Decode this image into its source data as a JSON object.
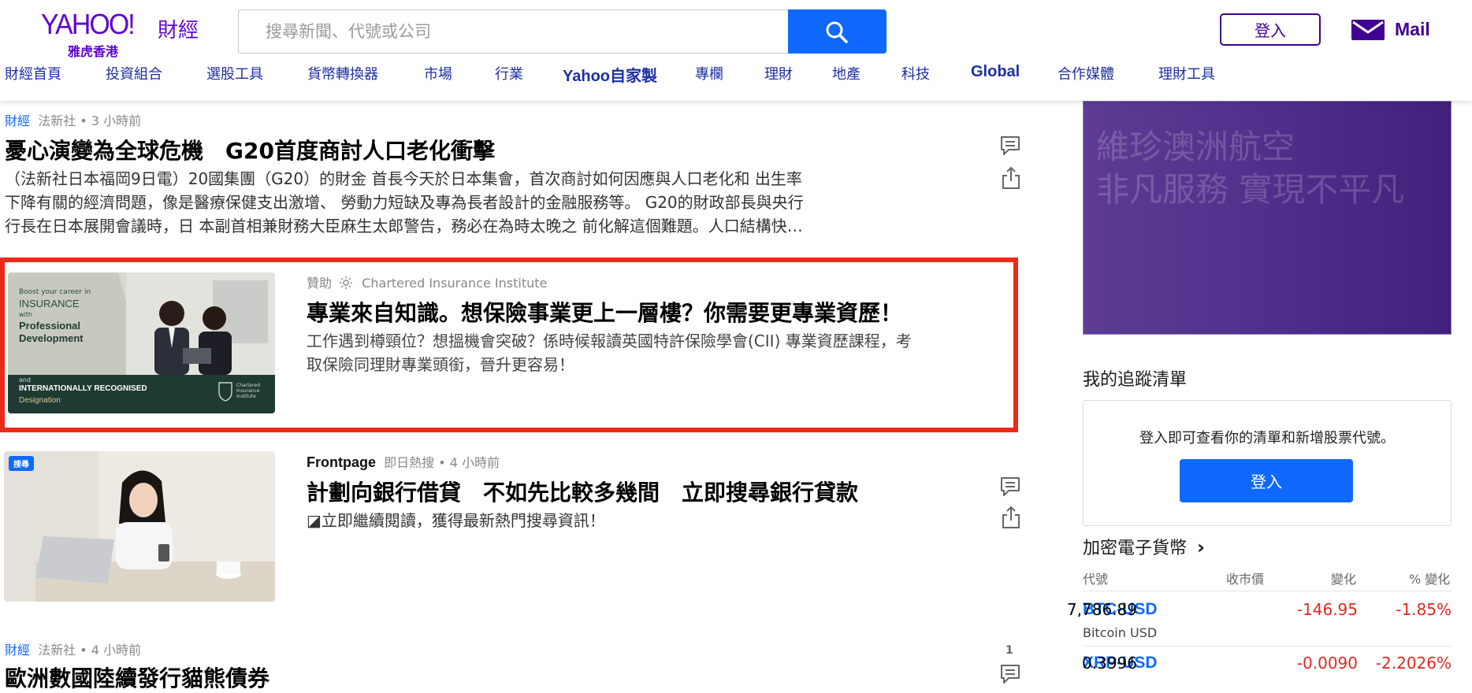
{
  "header": {
    "logo": {
      "brand": "YAHOO!",
      "section": "財經",
      "region": "雅虎香港"
    },
    "search": {
      "placeholder": "搜尋新聞、代號或公司"
    },
    "signin_label": "登入",
    "mail_label": "Mail",
    "nav": [
      "財經首頁",
      "投資組合",
      "選股工具",
      "貨幣轉換器",
      "市場",
      "行業",
      "Yahoo自家製",
      "專欄",
      "理財",
      "地產",
      "科技",
      "Global",
      "合作媒體",
      "理財工具"
    ]
  },
  "feed": {
    "item1": {
      "category": "財經",
      "meta": "法新社 • 3 小時前",
      "headline": "憂心演變為全球危機　G20首度商討人口老化衝擊",
      "summary_lines": [
        "（法新社日本福岡9日電）20國集團（G20）的財金 首長今天於日本集會，首次商討如何因應與人口老化和 出生率",
        "下降有關的經濟問題，像是醫療保健支出激增、 勞動力短缺及專為長者設計的金融服務等。 G20的財政部長與央行",
        "行長在日本展開會議時，日 本副首相兼財務大臣麻生太郎警告，務必在為時太晚之 前化解這個難題。人口結構快…"
      ]
    },
    "sponsored": {
      "label": "贊助",
      "advertiser": "Chartered Insurance Institute",
      "headline": "專業來自知識。想保險事業更上一層樓？你需要更專業資歷！",
      "summary_lines": [
        "工作遇到樽頸位？想搵機會突破？係時候報讀英國特許保險學會(CII) 專業資歷課程，考",
        "取保險同理財專業頭銜，晉升更容易！"
      ],
      "image_text": {
        "top": "Boost your career in",
        "insurance": "INSURANCE",
        "with": "with",
        "professional": "Professional",
        "development": "Development",
        "and": "and",
        "intl": "INTERNATIONALLY RECOGNISED",
        "designation": "Designation",
        "cii": "Chartered Insurance Institute"
      }
    },
    "item3": {
      "source": "Frontpage",
      "meta": "即日熱搜 • 4 小時前",
      "headline": "計劃向銀行借貸　不如先比較多幾間　立即搜尋銀行貸款",
      "summary": "◪立即繼續閱讀，獲得最新熱門搜尋資訊！",
      "badge": "搜尋"
    },
    "item4": {
      "category": "財經",
      "meta": "法新社 • 4 小時前",
      "headline": "歐洲數國陸續發行貓熊債券",
      "comment_count": "1"
    }
  },
  "rail": {
    "ad": {
      "line1": "維珍澳洲航空",
      "line2": "非凡服務 實現不平凡"
    },
    "watchlist": {
      "title": "我的追蹤清單",
      "message": "登入即可查看你的清單和新增股票代號。",
      "signin_label": "登入"
    },
    "crypto": {
      "title": "加密電子貨幣",
      "chevron": "›",
      "columns": [
        "代號",
        "收市價",
        "變化",
        "% 變化"
      ],
      "rows": [
        {
          "symbol": "BTC-USD",
          "name": "Bitcoin USD",
          "price": "7,786.89",
          "change": "-146.95",
          "pct": "-1.85%"
        },
        {
          "symbol": "XRP-USD",
          "name": "",
          "price": "0.3996",
          "change": "-0.0090",
          "pct": "-2.2026%"
        }
      ]
    }
  },
  "colors": {
    "accent": "#0f69ff",
    "brand": "#5f01d1",
    "negative": "#e0291f",
    "highlight": "#ec2a1a"
  },
  "icons": [
    "search-icon",
    "mail-icon",
    "comment-icon",
    "share-icon",
    "sun-icon",
    "chevron-right-icon"
  ]
}
